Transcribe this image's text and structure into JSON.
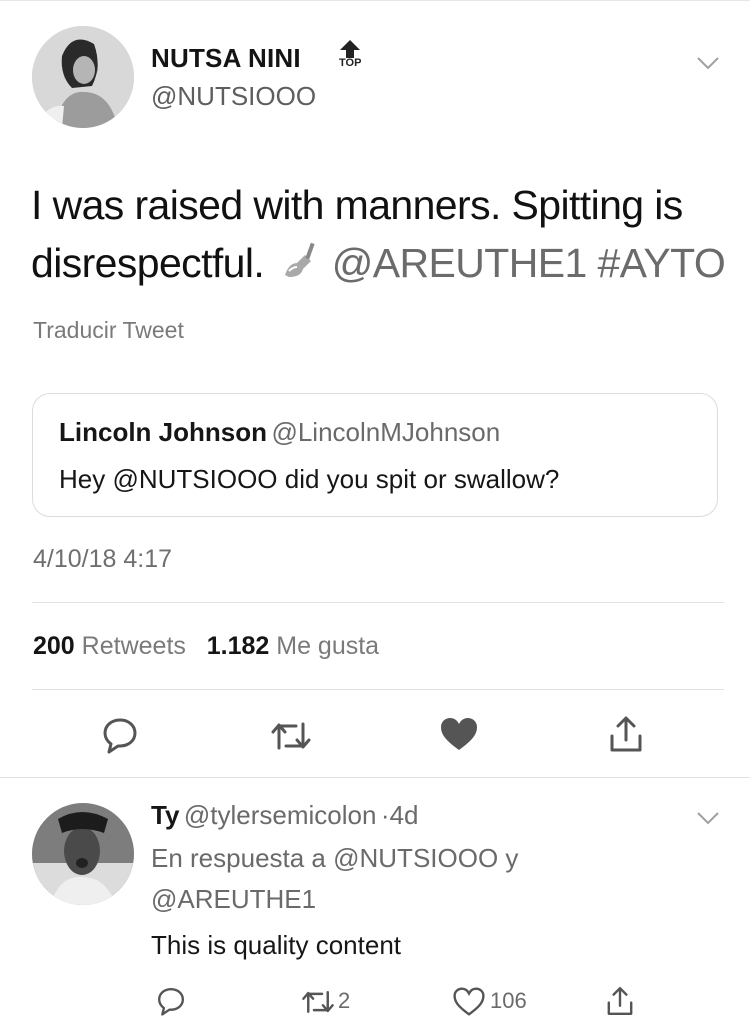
{
  "tweet": {
    "author": {
      "name": "NUTSA NINI",
      "handle": "@NUTSIOOO",
      "badge": "TOP"
    },
    "text_plain": "I was raised with manners. Spitting is disrespectful. ",
    "text_line1": "I was raised with manners. Spitting is",
    "text_line2": "disrespectful.",
    "emoji": "nail-polish",
    "mention": "@AREUTHE1",
    "hashtag": "#AYTO",
    "translate": "Traducir Tweet",
    "quoted": {
      "name": "Lincoln Johnson",
      "handle": "@LincolnMJohnson",
      "text": "Hey @NUTSIOOO did you spit or swallow?"
    },
    "timestamp": "4/10/18 4:17",
    "stats": {
      "retweets_count": "200",
      "retweets_label": "Retweets",
      "likes_count": "1.182",
      "likes_label": "Me gusta"
    },
    "actions": [
      "reply-icon",
      "retweet-icon",
      "like-icon",
      "share-icon"
    ]
  },
  "reply": {
    "name": "Ty",
    "handle": "@tylersemicolon",
    "separator": "·",
    "age": "4d",
    "in_reply_line1": "En respuesta a @NUTSIOOO y",
    "in_reply_line2": "@AREUTHE1",
    "text": "This is quality content",
    "retweets": "2",
    "likes": "106"
  }
}
